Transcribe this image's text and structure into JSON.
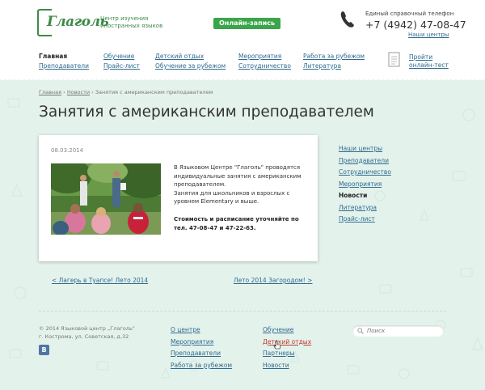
{
  "header": {
    "logo_text": "Глаголь",
    "tagline": "Центр изучения иностранных языков",
    "cta_label": "Онлайн-запись",
    "phone_caption": "Единый справочный телефон",
    "phone_number": "+7 (4942) 47-08-47",
    "phone_link": "Наши центры"
  },
  "nav": {
    "col1": [
      "Главная",
      "Преподаватели"
    ],
    "col2": [
      "Обучение",
      "Прайс-лист"
    ],
    "col3": [
      "Детский отдых",
      "Обучение за рубежом"
    ],
    "col4": [
      "Мероприятия",
      "Сотрудничество"
    ],
    "col5": [
      "Работа за рубежом",
      "Литература"
    ],
    "test_link": [
      "Пройти",
      "онлайн-тест"
    ]
  },
  "breadcrumb": {
    "home": "Главная",
    "news": "Новости",
    "current": "Занятия с американским преподавателем"
  },
  "page": {
    "title": "Занятия с американским преподавателем"
  },
  "article": {
    "date": "08.03.2014",
    "text": [
      "В Языковом Центре \"Глаголь\" проводятся индивидуальные занятия с американским преподавателем.",
      "Занятия для школьников и взрослых с уровнем Elementary и выше."
    ],
    "bold_text": "Стоимость и расписание уточняйте по тел. 47-08-47 и 47-22-63."
  },
  "sidebar": [
    "Наши центры",
    "Преподаватели",
    "Сотрудничество",
    "Мероприятия",
    "Новости",
    "Литература",
    "Прайс-лист"
  ],
  "pager": {
    "prev": "< Лагерь в Туапсе! Лето 2014",
    "next": "Лето 2014 Загородом! >"
  },
  "footer": {
    "copyright": "© 2014 Языковой центр „Глаголь\"",
    "address": "г. Кострома, ул. Советская, д.32",
    "vk_label": "В",
    "col1": [
      "О центре",
      "Мероприятия",
      "Преподаватели",
      "Работа за рубежом"
    ],
    "col2": [
      "Обучение",
      "Детский отдых",
      "Партнеры",
      "Новости"
    ],
    "search_placeholder": "Поиск"
  },
  "colors": {
    "accent": "#3aa54a",
    "link": "#2f6b8f",
    "background": "#e4f2ec"
  }
}
